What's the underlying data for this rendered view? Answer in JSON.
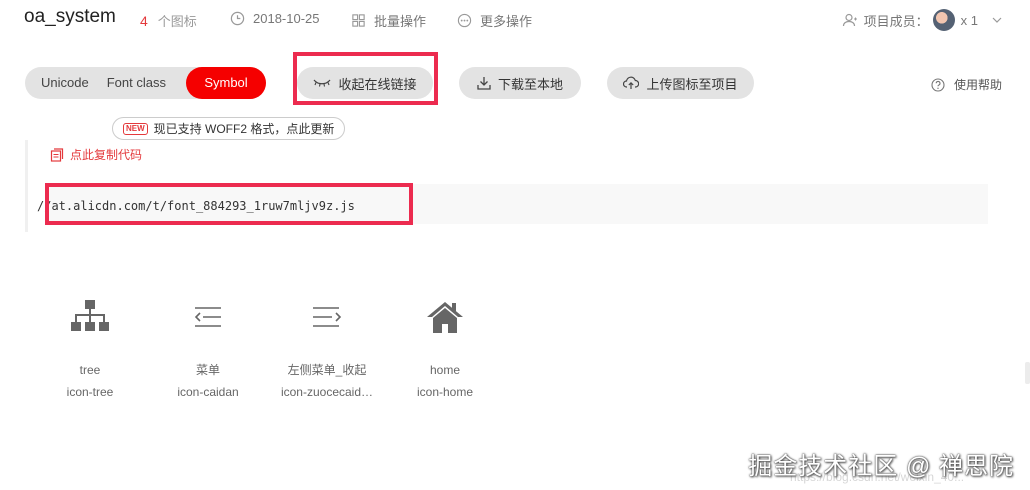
{
  "header": {
    "project_name": "oa_system",
    "icon_count": "4",
    "icon_count_label": "个图标",
    "date": "2018-10-25",
    "batch_ops": "批量操作",
    "more_ops": "更多操作",
    "members_label": "项目成员：",
    "members_count": "x 1"
  },
  "toolbar": {
    "tabs": [
      "Unicode",
      "Font class",
      "Symbol"
    ],
    "active_tab": "Symbol",
    "collapse_link": "收起在线链接",
    "download": "下载至本地",
    "upload": "上传图标至项目",
    "help": "使用帮助"
  },
  "notice": {
    "badge": "NEW",
    "text": "现已支持 WOFF2 格式，点此更新"
  },
  "code": {
    "copy_label": "点此复制代码",
    "url": "//at.alicdn.com/t/font_884293_1ruw7mljv9z.js"
  },
  "icons": [
    {
      "name": "tree",
      "class": "icon-tree",
      "glyph": "tree-icon"
    },
    {
      "name": "菜单",
      "class": "icon-caidan",
      "glyph": "menu-icon"
    },
    {
      "name": "左侧菜单_收起",
      "class": "icon-zuocecaid…",
      "glyph": "menu-collapse-icon"
    },
    {
      "name": "home",
      "class": "icon-home",
      "glyph": "home-icon"
    }
  ],
  "watermark": {
    "text": "掘金技术社区 @ 禅思院",
    "url": "https://blog.csdn.net/weixin_40..."
  },
  "colors": {
    "accent": "#f50000",
    "highlight": "#ec2b4f",
    "count_red": "#e4393c"
  }
}
